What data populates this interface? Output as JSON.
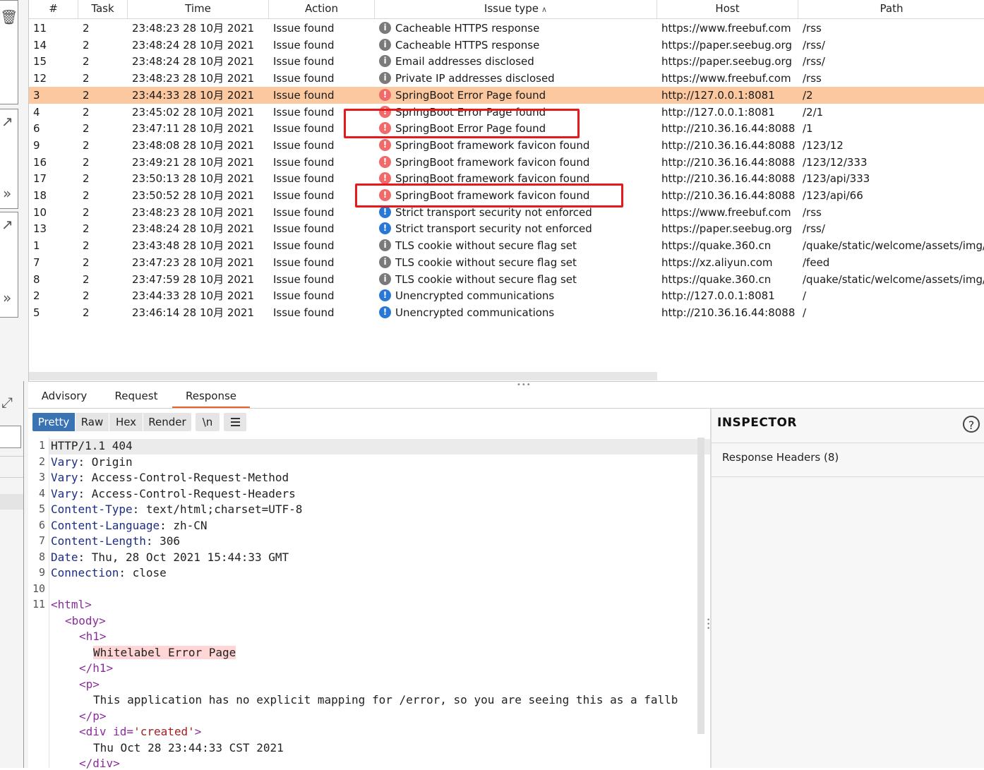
{
  "table": {
    "columns": [
      "#",
      "Task",
      "Time",
      "Action",
      "Issue type",
      "Host",
      "Path"
    ],
    "sorted_column": "Issue type",
    "rows": [
      {
        "num": "11",
        "task": "2",
        "time": "23:48:23 28 10月 2021",
        "action": "Issue found",
        "severity": "info",
        "issue": "Cacheable HTTPS response",
        "host": "https://www.freebuf.com",
        "path": "/rss"
      },
      {
        "num": "14",
        "task": "2",
        "time": "23:48:24 28 10月 2021",
        "action": "Issue found",
        "severity": "info",
        "issue": "Cacheable HTTPS response",
        "host": "https://paper.seebug.org",
        "path": "/rss/"
      },
      {
        "num": "15",
        "task": "2",
        "time": "23:48:24 28 10月 2021",
        "action": "Issue found",
        "severity": "info",
        "issue": "Email addresses disclosed",
        "host": "https://paper.seebug.org",
        "path": "/rss/"
      },
      {
        "num": "12",
        "task": "2",
        "time": "23:48:23 28 10月 2021",
        "action": "Issue found",
        "severity": "info",
        "issue": "Private IP addresses disclosed",
        "host": "https://www.freebuf.com",
        "path": "/rss"
      },
      {
        "num": "3",
        "task": "2",
        "time": "23:44:33 28 10月 2021",
        "action": "Issue found",
        "severity": "high",
        "issue": "SpringBoot Error Page found",
        "host": "http://127.0.0.1:8081",
        "path": "/2"
      },
      {
        "num": "4",
        "task": "2",
        "time": "23:45:02 28 10月 2021",
        "action": "Issue found",
        "severity": "high",
        "issue": "SpringBoot Error Page found",
        "host": "http://127.0.0.1:8081",
        "path": "/2/1"
      },
      {
        "num": "6",
        "task": "2",
        "time": "23:47:11 28 10月 2021",
        "action": "Issue found",
        "severity": "high",
        "issue": "SpringBoot Error Page found",
        "host": "http://210.36.16.44:8088",
        "path": "/1"
      },
      {
        "num": "9",
        "task": "2",
        "time": "23:48:08 28 10月 2021",
        "action": "Issue found",
        "severity": "high",
        "issue": "SpringBoot framework favicon found",
        "host": "http://210.36.16.44:8088",
        "path": "/123/12"
      },
      {
        "num": "16",
        "task": "2",
        "time": "23:49:21 28 10月 2021",
        "action": "Issue found",
        "severity": "high",
        "issue": "SpringBoot framework favicon found",
        "host": "http://210.36.16.44:8088",
        "path": "/123/12/333"
      },
      {
        "num": "17",
        "task": "2",
        "time": "23:50:13 28 10月 2021",
        "action": "Issue found",
        "severity": "high",
        "issue": "SpringBoot framework favicon found",
        "host": "http://210.36.16.44:8088",
        "path": "/123/api/333"
      },
      {
        "num": "18",
        "task": "2",
        "time": "23:50:52 28 10月 2021",
        "action": "Issue found",
        "severity": "high",
        "issue": "SpringBoot framework favicon found",
        "host": "http://210.36.16.44:8088",
        "path": "/123/api/66"
      },
      {
        "num": "10",
        "task": "2",
        "time": "23:48:23 28 10月 2021",
        "action": "Issue found",
        "severity": "low",
        "issue": "Strict transport security not enforced",
        "host": "https://www.freebuf.com",
        "path": "/rss"
      },
      {
        "num": "13",
        "task": "2",
        "time": "23:48:24 28 10月 2021",
        "action": "Issue found",
        "severity": "low",
        "issue": "Strict transport security not enforced",
        "host": "https://paper.seebug.org",
        "path": "/rss/"
      },
      {
        "num": "1",
        "task": "2",
        "time": "23:43:48 28 10月 2021",
        "action": "Issue found",
        "severity": "info",
        "issue": "TLS cookie without secure flag set",
        "host": "https://quake.360.cn",
        "path": "/quake/static/welcome/assets/img/i"
      },
      {
        "num": "7",
        "task": "2",
        "time": "23:47:23 28 10月 2021",
        "action": "Issue found",
        "severity": "info",
        "issue": "TLS cookie without secure flag set",
        "host": "https://xz.aliyun.com",
        "path": "/feed"
      },
      {
        "num": "8",
        "task": "2",
        "time": "23:47:59 28 10月 2021",
        "action": "Issue found",
        "severity": "info",
        "issue": "TLS cookie without secure flag set",
        "host": "https://quake.360.cn",
        "path": "/quake/static/welcome/assets/img/i"
      },
      {
        "num": "2",
        "task": "2",
        "time": "23:44:33 28 10月 2021",
        "action": "Issue found",
        "severity": "low",
        "issue": "Unencrypted communications",
        "host": "http://127.0.0.1:8081",
        "path": "/"
      },
      {
        "num": "5",
        "task": "2",
        "time": "23:46:14 28 10月 2021",
        "action": "Issue found",
        "severity": "low",
        "issue": "Unencrypted communications",
        "host": "http://210.36.16.44:8088",
        "path": "/"
      }
    ],
    "selected_index": 4
  },
  "tabs": [
    "Advisory",
    "Request",
    "Response"
  ],
  "active_tab": "Response",
  "toolbar": {
    "buttons": [
      "Pretty",
      "Raw",
      "Hex",
      "Render",
      "\\n"
    ],
    "active": "Pretty"
  },
  "editor": {
    "lines": [
      {
        "n": "1",
        "key": "HTTP/1.1 404",
        "val": ""
      },
      {
        "n": "2",
        "key": "Vary",
        "val": "Origin"
      },
      {
        "n": "3",
        "key": "Vary",
        "val": "Access-Control-Request-Method"
      },
      {
        "n": "4",
        "key": "Vary",
        "val": "Access-Control-Request-Headers"
      },
      {
        "n": "5",
        "key": "Content-Type",
        "val": "text/html;charset=UTF-8"
      },
      {
        "n": "6",
        "key": "Content-Language",
        "val": "zh-CN"
      },
      {
        "n": "7",
        "key": "Content-Length",
        "val": "306"
      },
      {
        "n": "8",
        "key": "Date",
        "val": "Thu, 28 Oct 2021 15:44:33 GMT"
      },
      {
        "n": "9",
        "key": "Connection",
        "val": "close"
      },
      {
        "n": "10",
        "key": "",
        "val": ""
      },
      {
        "n": "11",
        "key": "<html>",
        "val": ""
      }
    ],
    "body": {
      "body_tag": "<body>",
      "h1_open": "<h1>",
      "h1_text": "Whitelabel Error Page",
      "h1_close": "</h1>",
      "p_open": "<p>",
      "p_text": "This application has no explicit mapping for /error, so you are seeing this as a fallb",
      "p_close": "</p>",
      "div_open_pre": "<div id=",
      "div_open_attr": "'created'",
      "div_open_post": ">",
      "div_text": "Thu Oct 28 23:44:33 CST 2021",
      "div_close": "</div>"
    }
  },
  "inspector": {
    "title": "INSPECTOR",
    "help": "?",
    "sections": [
      "Response Headers (8)"
    ]
  },
  "colors": {
    "selected_row": "#fbc8a0",
    "annotation": "#e8191b",
    "active_button": "#3973b3",
    "tab_underline": "#e8602c"
  }
}
